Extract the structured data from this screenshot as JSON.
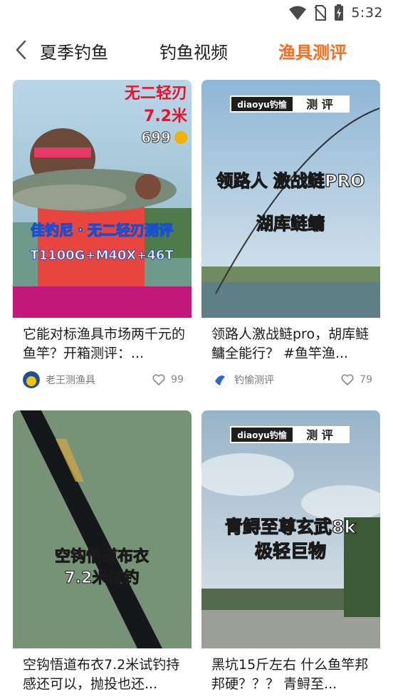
{
  "status_bar": {
    "time": "5:32"
  },
  "nav": {
    "tabs": [
      {
        "label": "夏季钓鱼",
        "active": false
      },
      {
        "label": "钓鱼视频",
        "active": false
      },
      {
        "label": "渔具测评",
        "active": true
      }
    ]
  },
  "cards": [
    {
      "title": "它能对标渔具市场两千元的鱼竿？开箱测评：...",
      "author": "老王测渔具",
      "likes": "99",
      "overlay": {
        "line1": "无二轻刃",
        "line2": "7.2米",
        "price": "699",
        "line3": "佳钓尼・无二轻刃测评",
        "line4": "T1100G+M40X+46T"
      }
    },
    {
      "title": "领路人激战鲢pro，胡库鲢鳙全能行？ #鱼竿渔...",
      "author": "钓愉测评",
      "likes": "79",
      "overlay": {
        "brand": "diaoyu钓愉",
        "tag": "测 评",
        "line1": "领路人 激战鲢PRO",
        "line2": "湖库鲢鳙"
      }
    },
    {
      "title": "空钩悟道布衣7.2米试钓持感还可以，抛投也还...",
      "author": "",
      "likes": "",
      "overlay": {
        "line1": "空钩悟道布衣",
        "line2": "7.2米试钓"
      }
    },
    {
      "title": "黑坑15斤左右 什么鱼竿邦邦硬？？？ 青鲟至...",
      "author": "",
      "likes": "",
      "overlay": {
        "brand": "diaoyu钓愉",
        "tag": "测 评",
        "line1": "青鲟至尊玄武8k",
        "line2": "极轻巨物"
      }
    }
  ],
  "colors": {
    "accent": "#ff6a1a",
    "text": "#1c1c1c",
    "meta": "#777777"
  }
}
